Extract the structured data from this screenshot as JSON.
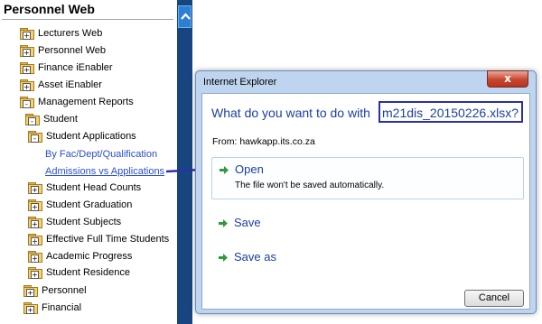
{
  "tree": {
    "title": "Personnel Web",
    "items": [
      {
        "label": "Lecturers Web",
        "sign": "+",
        "link": false
      },
      {
        "label": "Personnel Web",
        "sign": "+",
        "link": false
      },
      {
        "label": "Finance iEnabler",
        "sign": "+",
        "link": false
      },
      {
        "label": "Asset iEnabler",
        "sign": "+",
        "link": false
      },
      {
        "label": "Management Reports",
        "sign": "-",
        "link": false
      },
      {
        "label": "Student",
        "sign": "-",
        "link": false
      },
      {
        "label": "Student Applications",
        "sign": "-",
        "link": false
      },
      {
        "label": "By Fac/Dept/Qualification",
        "link": true
      },
      {
        "label": "Admissions vs Applications",
        "link": true
      },
      {
        "label": "Student Head Counts",
        "sign": "+",
        "link": false
      },
      {
        "label": "Student Graduation",
        "sign": "+",
        "link": false
      },
      {
        "label": "Student Subjects",
        "sign": "+",
        "link": false
      },
      {
        "label": "Effective Full Time Students",
        "sign": "+",
        "link": false
      },
      {
        "label": "Academic Progress",
        "sign": "+",
        "link": false
      },
      {
        "label": "Student Residence",
        "sign": "+",
        "link": false
      },
      {
        "label": "Personnel",
        "sign": "+",
        "link": false
      },
      {
        "label": "Financial",
        "sign": "+",
        "link": false
      }
    ]
  },
  "dialog": {
    "title": "Internet Explorer",
    "close_label": "x",
    "question": "What do you want to do with",
    "filename": "m21dis_20150226.xlsx?",
    "from": "From: hawkapp.its.co.za",
    "open_label": "Open",
    "open_sub": "The file won't be saved automatically.",
    "save_label": "Save",
    "save_as_label": "Save as",
    "cancel_label": "Cancel"
  },
  "colors": {
    "accent_blue": "#1b3f9e",
    "highlight_border": "#2b30a8",
    "scroll_strip": "#17457f",
    "arrow_green": "#2e9a3c"
  },
  "icons": {
    "folder": "folder-icon",
    "scroll_up": "chevron-up-icon",
    "option_arrow": "green-arrow-icon"
  }
}
